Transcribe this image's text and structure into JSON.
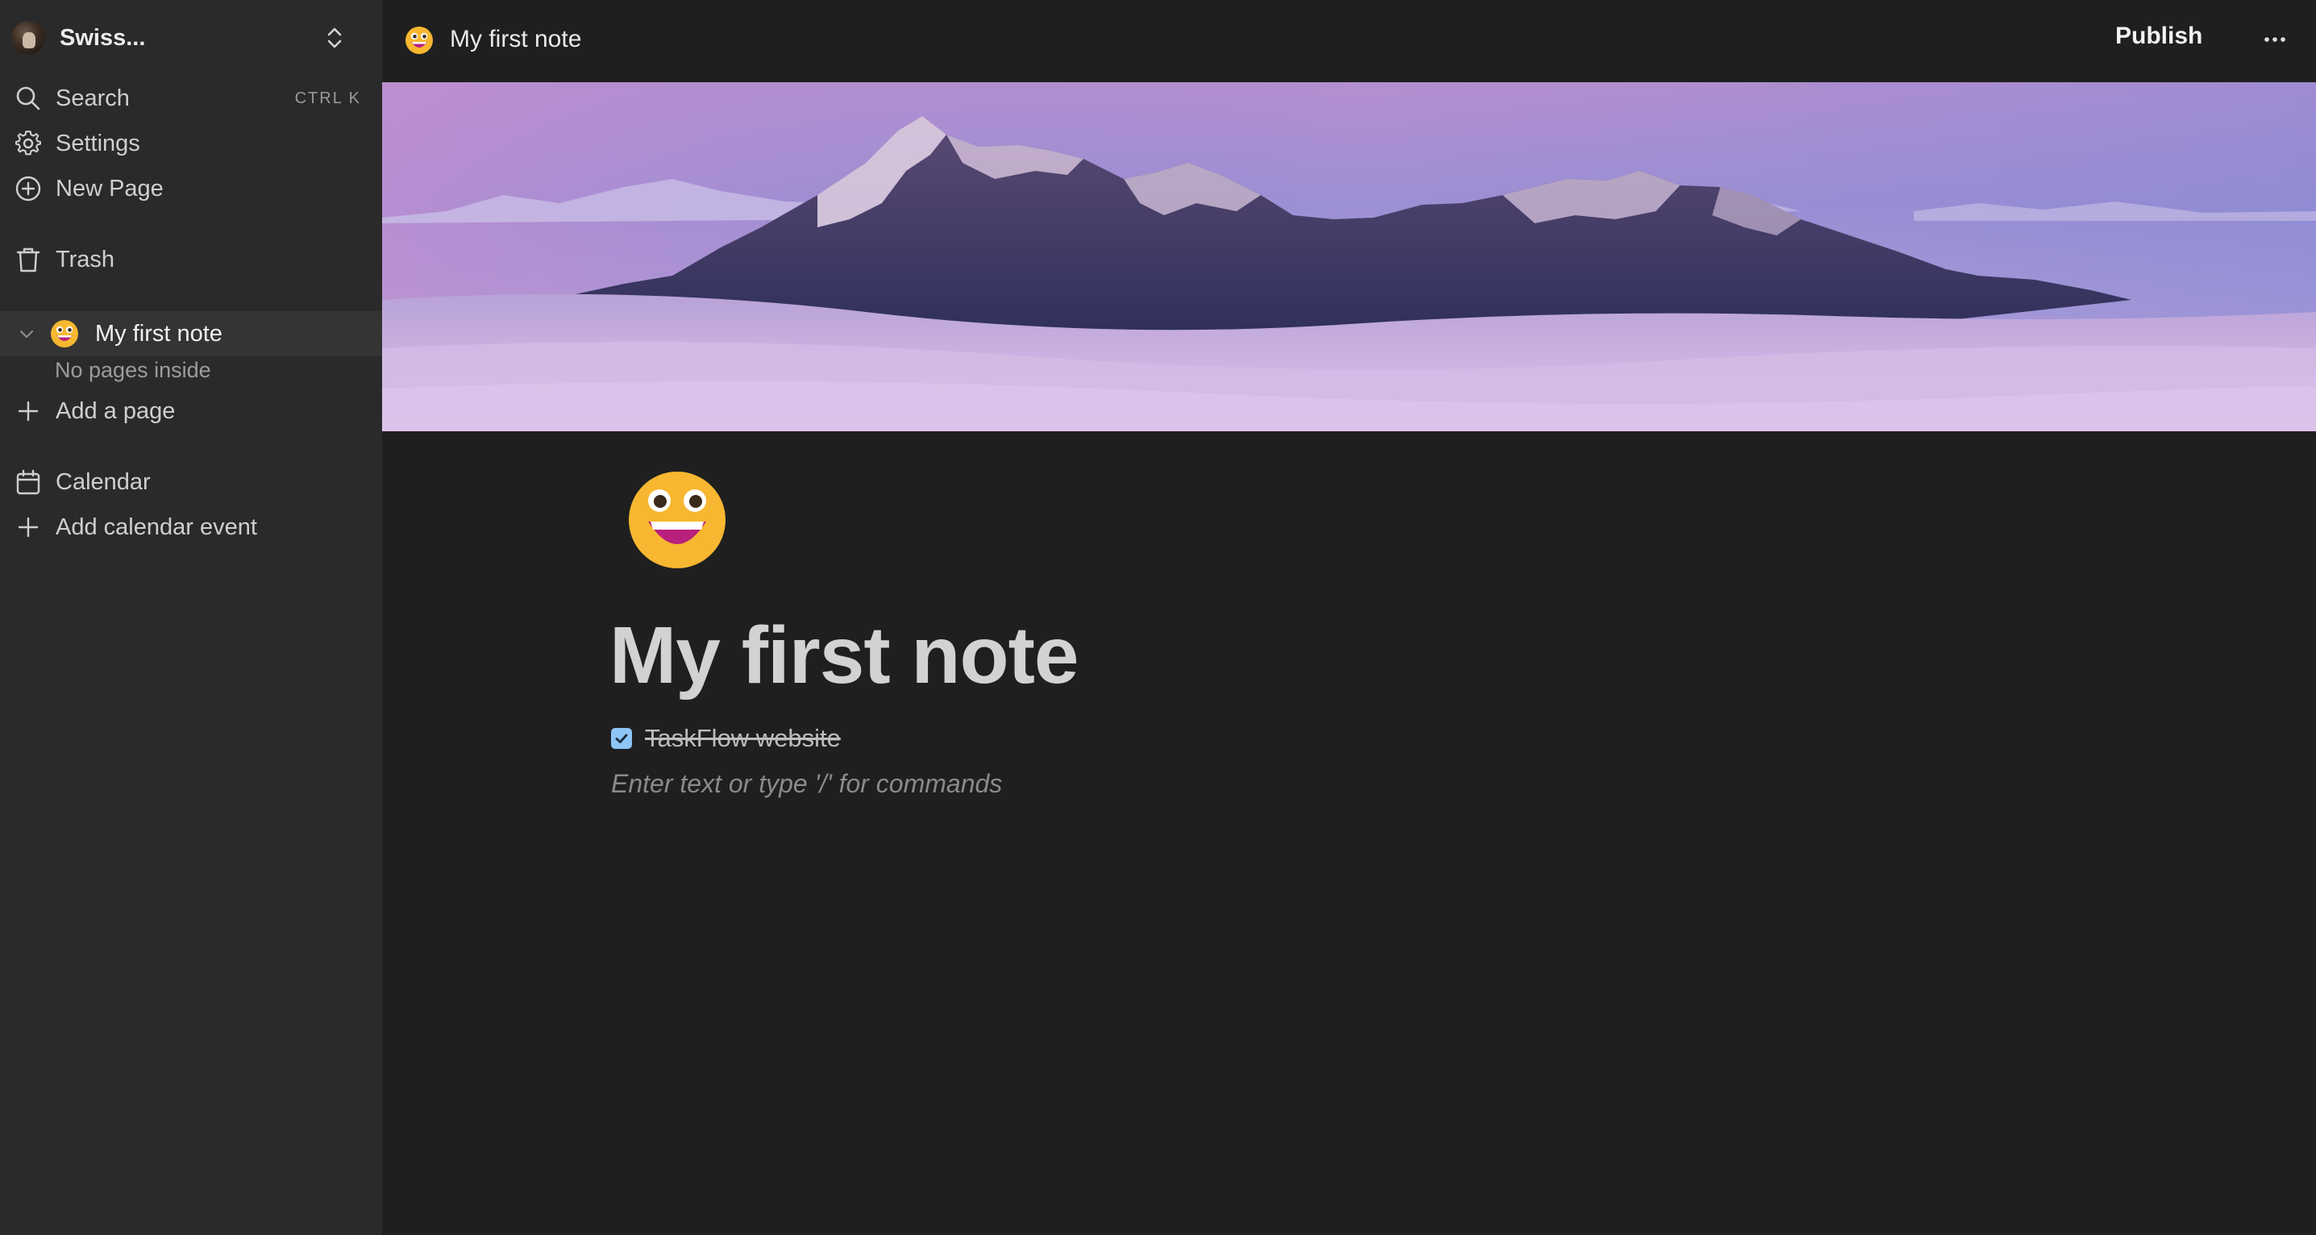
{
  "workspace": {
    "name": "Swiss..."
  },
  "sidebar": {
    "search": {
      "label": "Search",
      "shortcut": "CTRL K"
    },
    "settings": {
      "label": "Settings"
    },
    "new_page": {
      "label": "New Page"
    },
    "trash": {
      "label": "Trash"
    },
    "pages": [
      {
        "title": "My first note",
        "emoji": "grinning-face",
        "expanded": true,
        "empty_text": "No pages inside"
      }
    ],
    "add_page": {
      "label": "Add a page"
    },
    "calendar": {
      "label": "Calendar"
    },
    "add_event": {
      "label": "Add calendar event"
    }
  },
  "topbar": {
    "page_title": "My first note",
    "publish_label": "Publish"
  },
  "page": {
    "title": "My first note",
    "icon": "grinning-face",
    "cover": "snowy-mountain-above-clouds",
    "todos": [
      {
        "text": "TaskFlow website",
        "checked": true
      }
    ],
    "placeholder": "Enter text or type '/' for commands"
  },
  "colors": {
    "sidebar_bg": "#2a2a2a",
    "main_bg": "#1f1f1f",
    "active_row": "#343434",
    "checkbox": "#8ec5f7"
  }
}
